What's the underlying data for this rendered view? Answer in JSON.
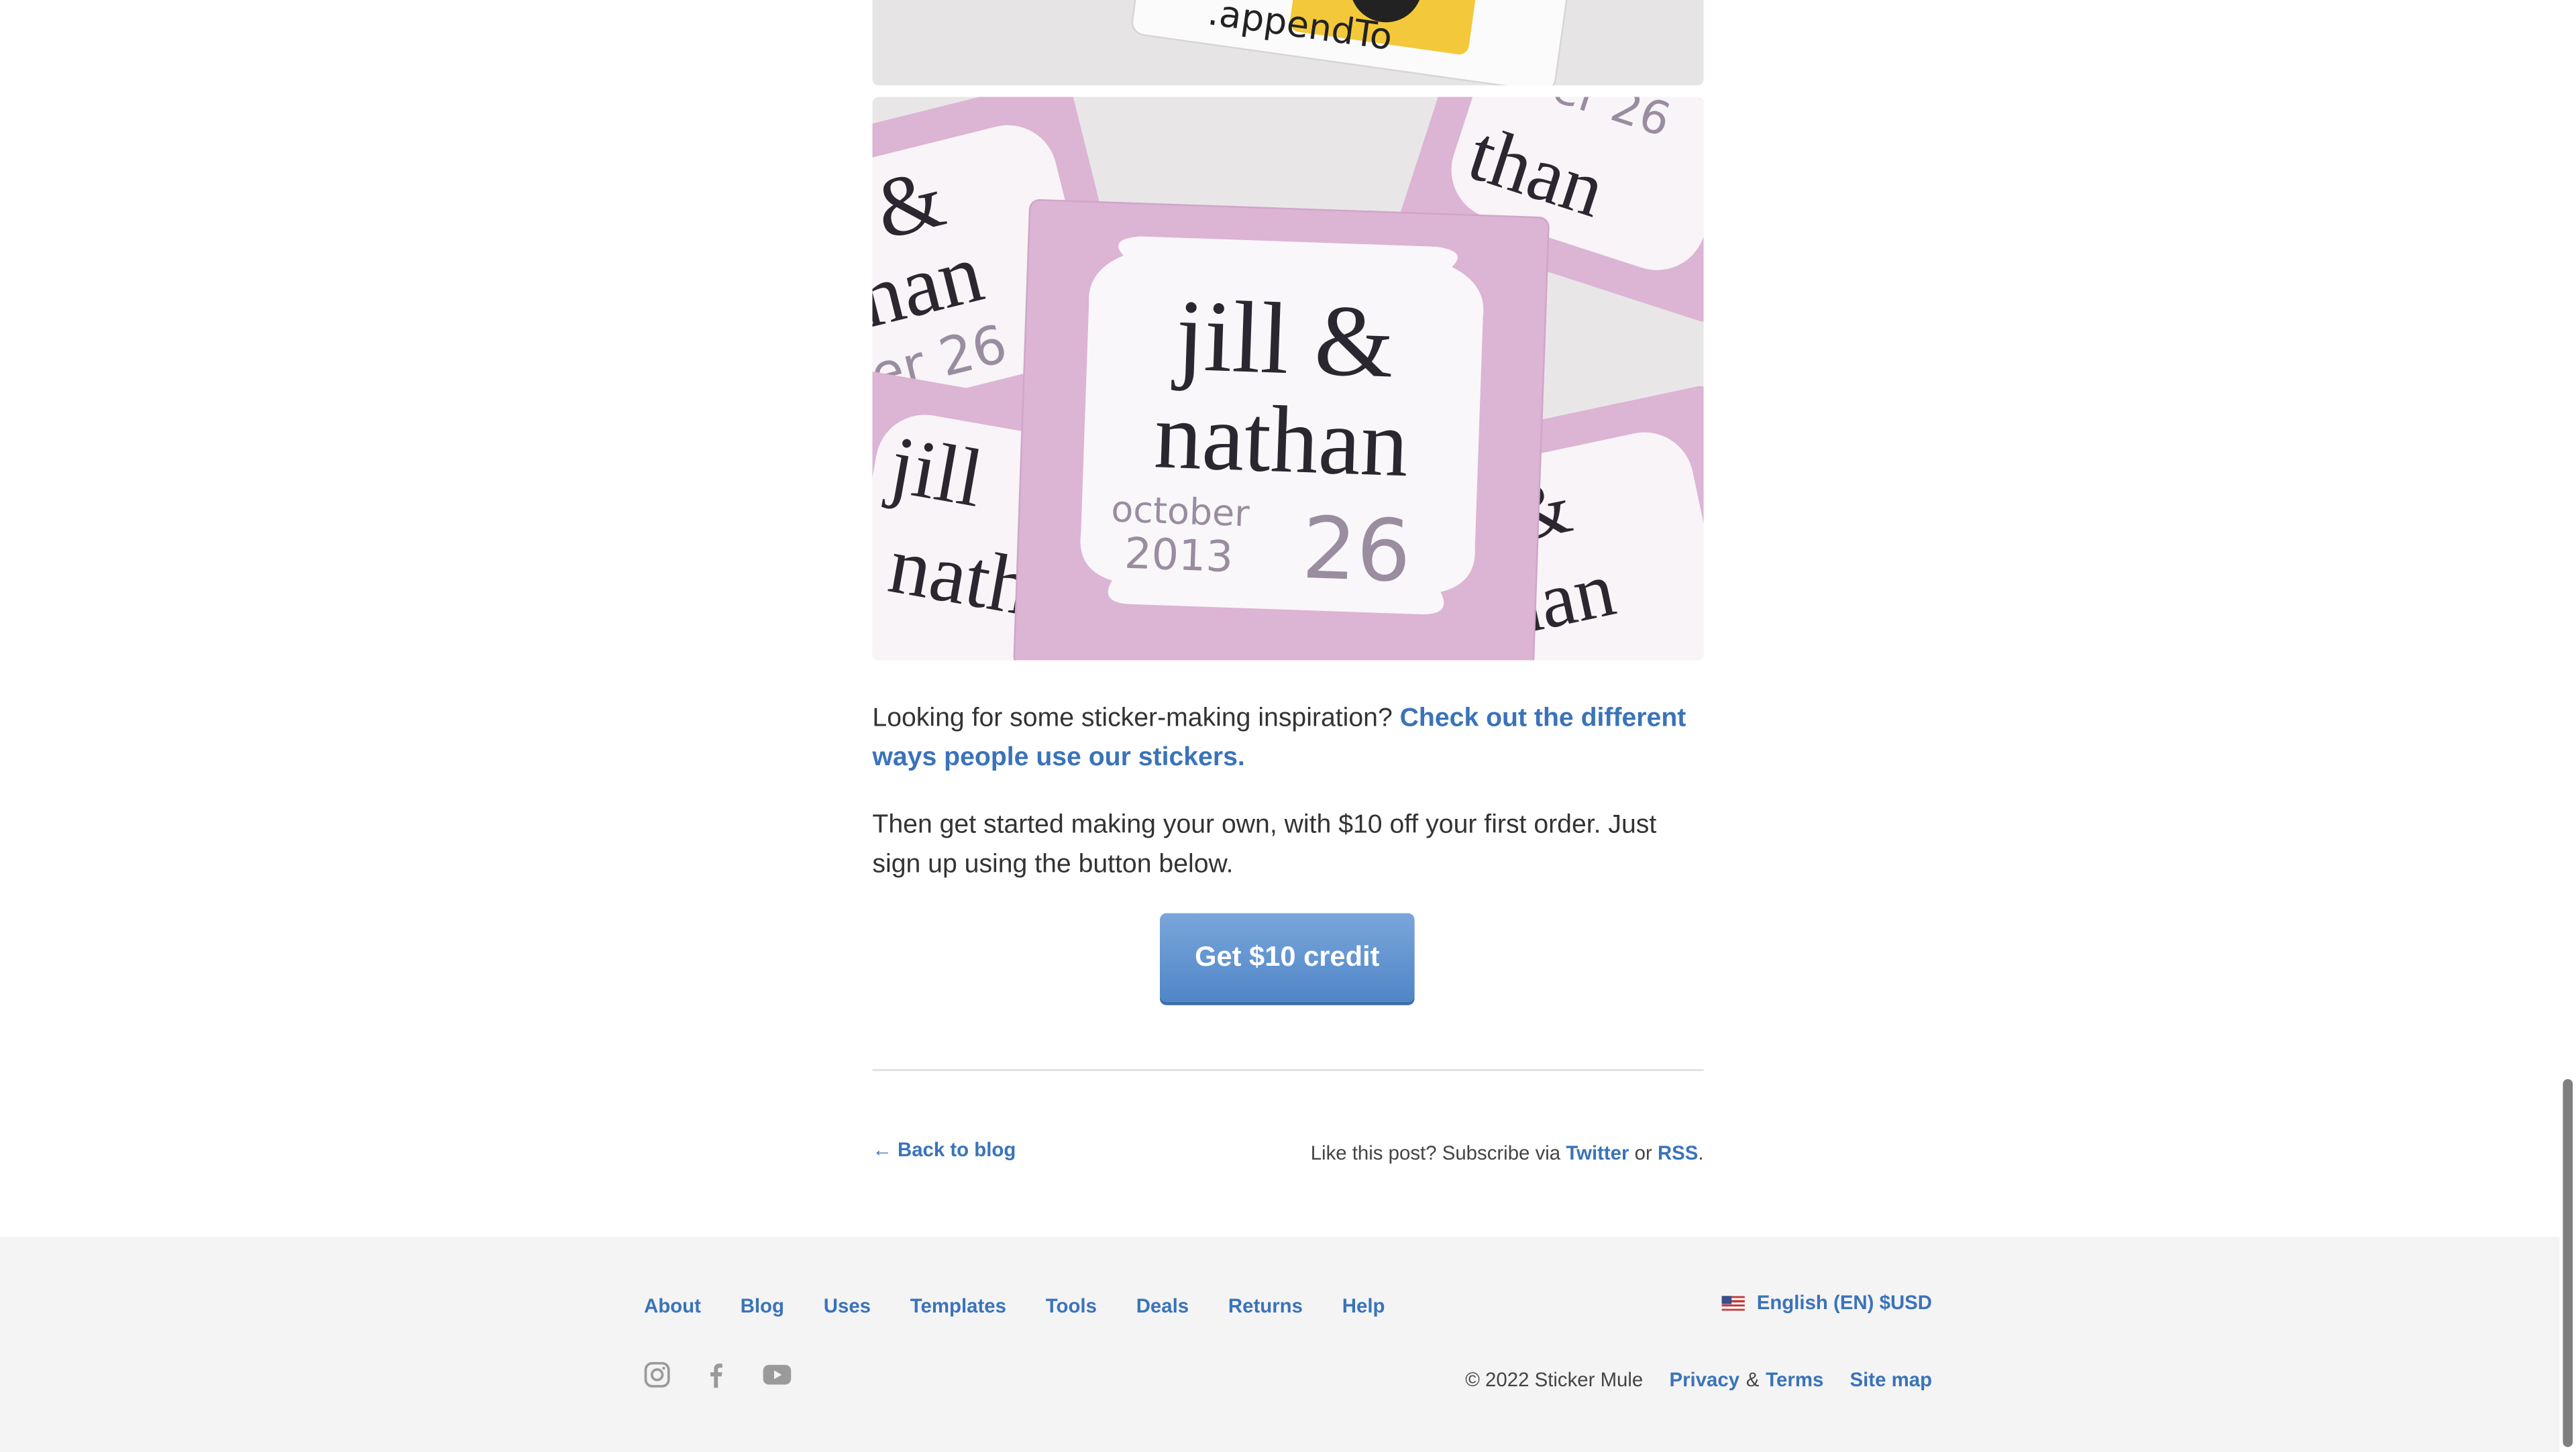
{
  "images": {
    "top_sticker_text": ".appendTo",
    "main_sticker": {
      "line1": "jill &",
      "line2": "nathan",
      "month": "october",
      "year": "2013",
      "day": "26"
    }
  },
  "article": {
    "p1_text": "Looking for some sticker-making inspiration? ",
    "p1_link": "Check out the different ways people use our stickers.",
    "p2_text": "Then get started making your own, with $10 off your first order. Just sign up using the button below.",
    "cta_label": "Get $10 credit"
  },
  "post_nav": {
    "back_label": "← Back to blog",
    "subscribe_prefix": "Like this post? Subscribe via ",
    "twitter": "Twitter",
    "or": " or ",
    "rss": "RSS",
    "suffix": "."
  },
  "footer": {
    "nav": [
      "About",
      "Blog",
      "Uses",
      "Templates",
      "Tools",
      "Deals",
      "Returns",
      "Help"
    ],
    "language": "English (EN) $USD",
    "social_icons": [
      "instagram-icon",
      "facebook-icon",
      "youtube-icon"
    ],
    "copyright": "© 2022 Sticker Mule",
    "privacy": "Privacy",
    "amp": "&",
    "terms": "Terms",
    "sitemap": "Site map"
  },
  "colors": {
    "link": "#3a73b9",
    "cta": "#5b8fce",
    "footer_bg": "#f4f4f5",
    "sticker_pink": "#dcb4d4"
  }
}
